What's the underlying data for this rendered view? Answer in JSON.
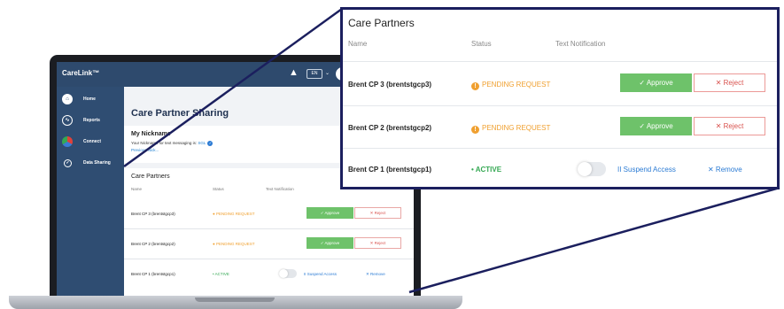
{
  "app": {
    "brand": "CareLink™",
    "language": "EN"
  },
  "sidebar": {
    "items": [
      {
        "label": "Home",
        "icon": "home-icon"
      },
      {
        "label": "Reports",
        "icon": "reports-icon"
      },
      {
        "label": "Connect",
        "icon": "connect-icon"
      },
      {
        "label": "Data Sharing",
        "icon": "data-sharing-icon"
      }
    ]
  },
  "page": {
    "title": "Care Partner Sharing"
  },
  "nickname": {
    "title": "My Nickname",
    "description": "Your Nickname for text messaging is: ",
    "value": "SGL",
    "link": "Previous Nick..."
  },
  "care_partners": {
    "title": "Care Partners",
    "headers": {
      "name": "Name",
      "status": "Status",
      "text": "Text Notification"
    },
    "rows": [
      {
        "name": "Brent CP 3 (brentstgcp3)",
        "status": "PENDING REQUEST",
        "approve": "✓ Approve",
        "reject": "✕ Reject"
      },
      {
        "name": "Brent CP 2 (brentstgcp2)",
        "status": "PENDING REQUEST",
        "approve": "✓ Approve",
        "reject": "✕ Reject"
      },
      {
        "name": "Brent CP 1 (brentstgcp1)",
        "status": "• ACTIVE",
        "suspend": "II  Suspend Access",
        "remove": "✕  Remove"
      }
    ]
  },
  "colors": {
    "nav": "#2f4d72",
    "approve": "#6ec26a",
    "reject": "#d9534f",
    "pending": "#f0a030",
    "active": "#35a853",
    "link": "#2b7bd4",
    "callout_border": "#1b1f5e"
  }
}
